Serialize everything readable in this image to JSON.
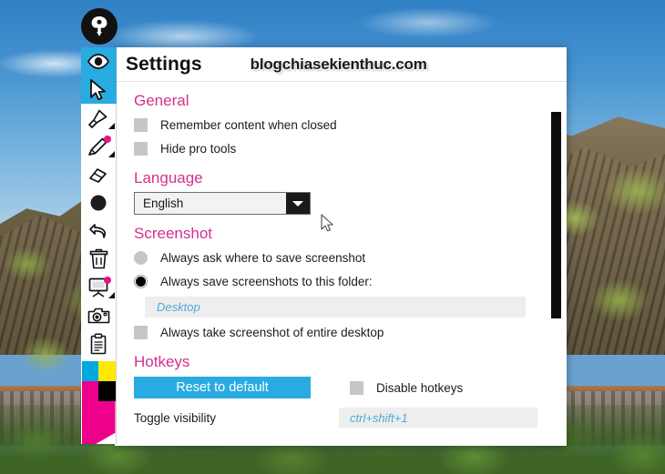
{
  "app": {
    "logo_icon": "pen-nib-icon",
    "window_title": "Settings",
    "watermark": "blogchiasekienthuc.com"
  },
  "toolbar": {
    "items": [
      {
        "name": "eye-icon",
        "label": "Show / hide",
        "selected": true,
        "badge": false,
        "corner": false
      },
      {
        "name": "cursor-icon",
        "label": "Select",
        "selected": true,
        "badge": false,
        "corner": false
      },
      {
        "name": "highlighter-icon",
        "label": "Highlighter",
        "selected": false,
        "badge": false,
        "corner": true
      },
      {
        "name": "pencil-icon",
        "label": "Pencil",
        "selected": false,
        "badge": true,
        "corner": true
      },
      {
        "name": "eraser-icon",
        "label": "Eraser",
        "selected": false,
        "badge": false,
        "corner": false
      },
      {
        "name": "circle-icon",
        "label": "Shape",
        "selected": false,
        "badge": false,
        "corner": false
      },
      {
        "name": "undo-icon",
        "label": "Undo",
        "selected": false,
        "badge": false,
        "corner": false
      },
      {
        "name": "trash-icon",
        "label": "Clear",
        "selected": false,
        "badge": false,
        "corner": false
      },
      {
        "name": "whiteboard-icon",
        "label": "Whiteboard",
        "selected": false,
        "badge": true,
        "corner": true
      },
      {
        "name": "camera-icon",
        "label": "Screenshot",
        "selected": false,
        "badge": false,
        "corner": false
      },
      {
        "name": "clipboard-icon",
        "label": "Clipboard",
        "selected": false,
        "badge": false,
        "corner": false
      }
    ],
    "palette": {
      "cyan": "#00a8e0",
      "yellow": "#ffe900",
      "magenta": "#ec008c",
      "black": "#000000"
    }
  },
  "settings": {
    "sections": {
      "general": {
        "heading": "General",
        "options": [
          {
            "label": "Remember content when closed",
            "checked": false
          },
          {
            "label": "Hide pro tools",
            "checked": false
          }
        ]
      },
      "language": {
        "heading": "Language",
        "selected": "English",
        "options": [
          "English"
        ],
        "dropdown_icon": "chevron-down-icon"
      },
      "screenshot": {
        "heading": "Screenshot",
        "radios": [
          {
            "label": "Always ask where to save screenshot",
            "selected": false
          },
          {
            "label": "Always save screenshots to this folder:",
            "selected": true
          }
        ],
        "folder_value": "Desktop",
        "entire_desktop": {
          "label": "Always take screenshot of entire desktop",
          "checked": false
        }
      },
      "hotkeys": {
        "heading": "Hotkeys",
        "reset_label": "Reset to default",
        "disable_label": "Disable hotkeys",
        "disable_checked": false,
        "entries": [
          {
            "label": "Toggle visibility",
            "value": "ctrl+shift+1"
          }
        ]
      }
    }
  },
  "colors": {
    "accent_pink": "#d4318c",
    "accent_blue": "#29abe2",
    "link_blue": "#4fa8d8",
    "checkbox_gray": "#c6c6c6"
  },
  "cursor": {
    "icon": "arrow-pointer-icon"
  }
}
